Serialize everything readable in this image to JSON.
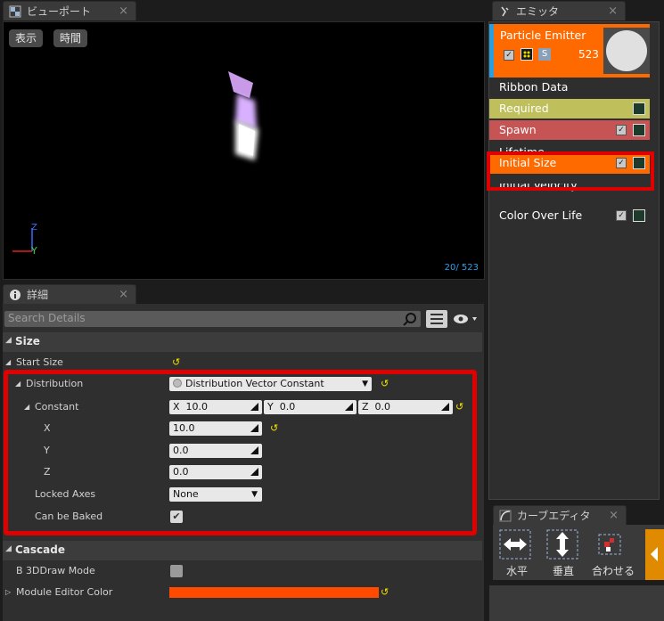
{
  "viewport_tab": {
    "label": "ビューポート",
    "close": "×"
  },
  "viewport": {
    "show_label": "表示",
    "time_label": "時間",
    "axis_z": "Z",
    "axis_y": "Y",
    "counter": "20/ 523"
  },
  "emitter_tab": {
    "label": "エミッタ",
    "close": "×"
  },
  "emitter": {
    "name": "Particle Emitter",
    "count": "523",
    "s_badge": "S",
    "modules": [
      {
        "label": "Ribbon Data",
        "color": "#2e2e2e"
      },
      {
        "label": "Required",
        "color": "#bfbf5c"
      },
      {
        "label": "Spawn",
        "color": "#c75454"
      },
      {
        "label": "Lifetime",
        "color": "#2e2e2e"
      },
      {
        "label": "Initial Size",
        "color": "#ff6a00"
      },
      {
        "label": "Initial Velocity",
        "color": "#2e2e2e"
      },
      {
        "label": "Color Over Life",
        "color": "#2e2e2e"
      }
    ]
  },
  "details_tab": {
    "label": "詳細",
    "close": "×"
  },
  "details": {
    "search_placeholder": "Search Details",
    "section_size": "Size",
    "start_size": "Start Size",
    "distribution": "Distribution",
    "distribution_value": "Distribution Vector Constant",
    "constant": "Constant",
    "const_x_label": "X",
    "const_x_value": "10.0",
    "const_y_label": "Y",
    "const_y_value": "0.0",
    "const_z_label": "Z",
    "const_z_value": "0.0",
    "x_label": "X",
    "x_value": "10.0",
    "y_label": "Y",
    "y_value": "0.0",
    "z_label": "Z",
    "z_value": "0.0",
    "locked_axes": "Locked Axes",
    "locked_axes_value": "None",
    "can_be_baked": "Can be Baked",
    "section_cascade": "Cascade",
    "b3d_draw_mode": "B 3DDraw Mode",
    "module_editor_color": "Module Editor Color",
    "module_color": "#ff4a00"
  },
  "curve_tab": {
    "label": "カーブエディタ",
    "close": "×"
  },
  "curve": {
    "horizontal": "水平",
    "vertical": "垂直",
    "fit": "合わせる"
  }
}
